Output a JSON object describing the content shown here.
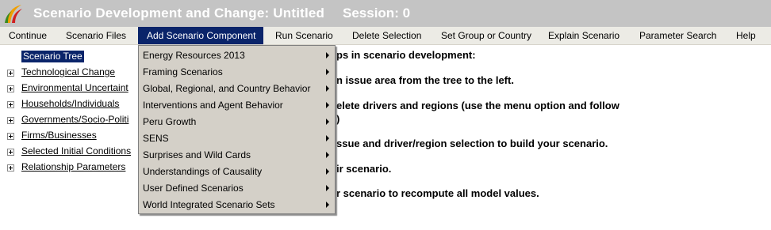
{
  "title": {
    "app_title": "Scenario Development and Change: Untitled",
    "session": "Session: 0"
  },
  "colors": {
    "titlebar_bg": "#c4c4c4",
    "menubar_bg": "#ecebe5",
    "highlight": "#0a246a",
    "dropdown_bg": "#d4d0c8"
  },
  "menu": {
    "items": [
      "Continue",
      "Scenario Files",
      "Add Scenario Component",
      "Run Scenario",
      "Delete Selection",
      "Set Group or Country",
      "Explain Scenario",
      "Parameter Search",
      "Help"
    ],
    "active_index": 2
  },
  "tree": {
    "root": "Scenario Tree",
    "nodes": [
      "Technological Change",
      "Environmental Uncertaint",
      "Households/Individuals",
      "Governments/Socio-Politi",
      "Firms/Businesses",
      "Selected Initial Conditions",
      "Relationship Parameters"
    ]
  },
  "instructions": {
    "lines": [
      "ps in scenario development:",
      "n issue area from the tree to the left.",
      "elete drivers and regions (use the menu option and follow",
      ")",
      "ssue and driver/region selection to build your scenario.",
      "ir scenario.",
      "r scenario to recompute all model values."
    ]
  },
  "dropdown": {
    "items": [
      "Energy Resources 2013",
      "Framing Scenarios",
      "Global, Regional, and Country Behavior",
      "Interventions and Agent Behavior",
      "Peru Growth",
      "SENS",
      "Surprises and Wild Cards",
      "Understandings of Causality",
      "User Defined Scenarios",
      "World Integrated Scenario Sets"
    ]
  }
}
